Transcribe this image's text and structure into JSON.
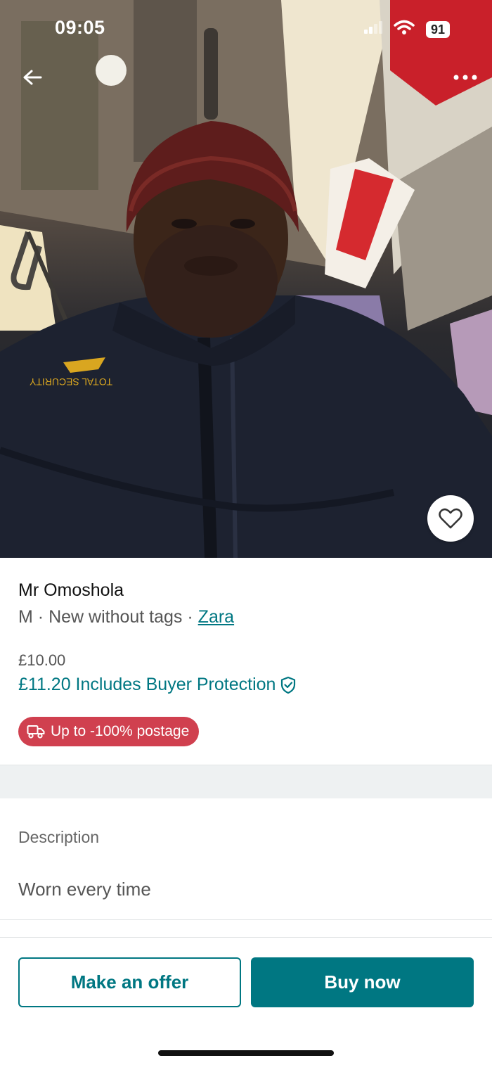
{
  "status_bar": {
    "time": "09:05",
    "battery": "91",
    "icons": [
      "cellular-icon",
      "wifi-icon",
      "battery-icon"
    ]
  },
  "top_bar": {
    "icons": [
      "back-arrow-icon",
      "more-dots-icon"
    ]
  },
  "photo": {
    "jacket_logo_text": "TOTAL SECURITY",
    "favourite_icon": "heart-icon"
  },
  "item": {
    "title": "Mr Omoshola",
    "size": "M",
    "condition": "New without tags",
    "separator": "·",
    "brand": "Zara",
    "price": "£10.00",
    "total_price": "£11.20 Includes Buyer Protection",
    "protection_icon": "shield-check-icon",
    "promo_label": "Up to -100% postage",
    "promo_icon": "truck-icon"
  },
  "description": {
    "heading": "Description",
    "text": "Worn every time"
  },
  "actions": {
    "offer_label": "Make an offer",
    "buy_label": "Buy now"
  },
  "colors": {
    "accent": "#007782",
    "promo": "#d0404f"
  }
}
